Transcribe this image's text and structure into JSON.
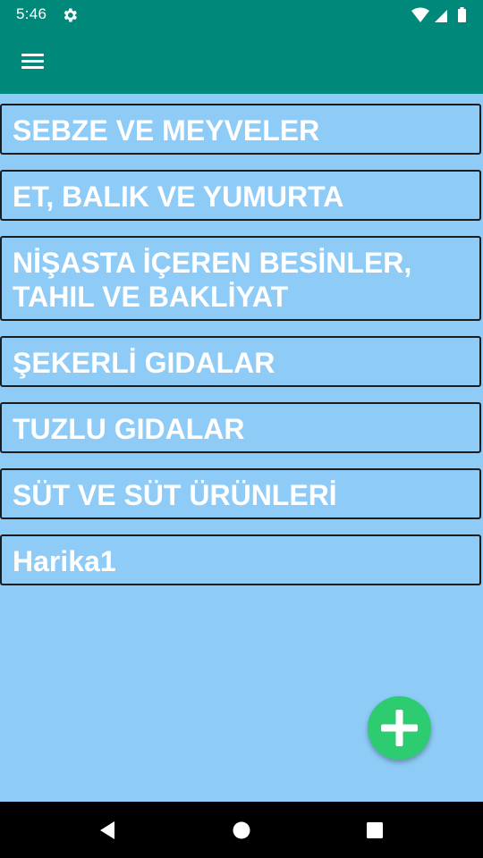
{
  "status_bar": {
    "time": "5:46",
    "icons": [
      "gear-icon",
      "wifi-icon",
      "signal-icon",
      "battery-icon"
    ]
  },
  "app_bar": {
    "menu_icon": "hamburger-menu-icon",
    "background_color": "#00897b"
  },
  "categories": [
    {
      "label": "SEBZE VE MEYVELER"
    },
    {
      "label": "ET, BALIK VE YUMURTA"
    },
    {
      "label": "NİŞASTA İÇEREN BESİNLER, TAHIL VE BAKLİYAT"
    },
    {
      "label": "ŞEKERLİ GIDALAR"
    },
    {
      "label": "TUZLU GIDALAR"
    },
    {
      "label": "SÜT VE SÜT ÜRÜNLERİ"
    },
    {
      "label": "Harika1"
    }
  ],
  "fab": {
    "icon": "plus-icon",
    "color": "#2ecc71"
  },
  "nav_bar": {
    "buttons": [
      "back-icon",
      "home-icon",
      "recents-icon"
    ]
  },
  "colors": {
    "background": "#8ecbf7",
    "item_text": "#ffffff",
    "item_border": "#1c1c1c"
  }
}
